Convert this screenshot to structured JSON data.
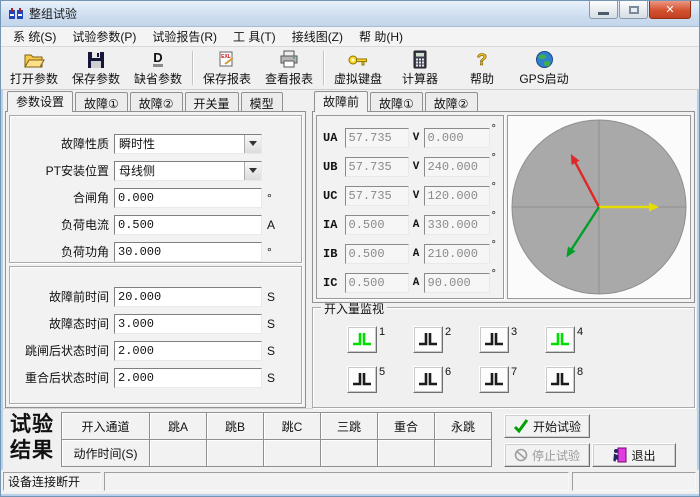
{
  "window": {
    "title": "整组试验"
  },
  "controls": {
    "minimize": "minimize",
    "maximize": "maximize",
    "close": "✕"
  },
  "menu": {
    "items": [
      {
        "label": "系 统(S)"
      },
      {
        "label": "试验参数(P)"
      },
      {
        "label": "试验报告(R)"
      },
      {
        "label": "工 具(T)"
      },
      {
        "label": "接线图(Z)"
      },
      {
        "label": "帮 助(H)"
      }
    ]
  },
  "toolbar": {
    "buttons": [
      {
        "label": "打开参数",
        "icon": "open-folder-icon"
      },
      {
        "label": "保存参数",
        "icon": "save-floppy-icon"
      },
      {
        "label": "缺省参数",
        "icon": "default-params-icon"
      },
      {
        "label": "保存报表",
        "icon": "save-report-icon"
      },
      {
        "label": "查看报表",
        "icon": "printer-icon"
      },
      {
        "label": "虚拟键盘",
        "icon": "key-icon"
      },
      {
        "label": "计算器",
        "icon": "calculator-icon"
      },
      {
        "label": "帮助",
        "icon": "help-icon"
      },
      {
        "label": "GPS启动",
        "icon": "globe-icon"
      }
    ]
  },
  "left_panel": {
    "tabs": [
      "参数设置",
      "故障①",
      "故障②",
      "开关量",
      "模型"
    ],
    "active_tab": "参数设置",
    "params": [
      {
        "label": "故障性质",
        "value": "瞬时性",
        "type": "select"
      },
      {
        "label": "PT安装位置",
        "value": "母线侧",
        "type": "select"
      },
      {
        "label": "合闸角",
        "value": "0.000",
        "unit": "°"
      },
      {
        "label": "负荷电流",
        "value": "0.500",
        "unit": "A"
      },
      {
        "label": "负荷功角",
        "value": "30.000",
        "unit": "°"
      }
    ],
    "times": [
      {
        "label": "故障前时间",
        "value": "20.000",
        "unit": "S"
      },
      {
        "label": "故障态时间",
        "value": "3.000",
        "unit": "S"
      },
      {
        "label": "跳闸后状态时间",
        "value": "2.000",
        "unit": "S"
      },
      {
        "label": "重合后状态时间",
        "value": "2.000",
        "unit": "S"
      }
    ]
  },
  "right_panel": {
    "tabs": [
      "故障前",
      "故障①",
      "故障②"
    ],
    "active_tab": "故障前",
    "channels": [
      {
        "name": "UA",
        "value": "57.735",
        "unit": "V",
        "angle": "0.000",
        "deg": "°"
      },
      {
        "name": "UB",
        "value": "57.735",
        "unit": "V",
        "angle": "240.000",
        "deg": "°"
      },
      {
        "name": "UC",
        "value": "57.735",
        "unit": "V",
        "angle": "120.000",
        "deg": "°"
      },
      {
        "name": "IA",
        "value": "0.500",
        "unit": "A",
        "angle": "330.000",
        "deg": "°"
      },
      {
        "name": "IB",
        "value": "0.500",
        "unit": "A",
        "angle": "210.000",
        "deg": "°"
      },
      {
        "name": "IC",
        "value": "0.500",
        "unit": "A",
        "angle": "90.000",
        "deg": "°"
      }
    ],
    "phasor": {
      "circle_color": "#a9a9a9",
      "axis_color": "#8f8f8f",
      "vectors": [
        {
          "name": "UC",
          "angle_deg": 118,
          "color": "#e02828"
        },
        {
          "name": "UA",
          "angle_deg": 0,
          "color": "#e6de00"
        },
        {
          "name": "UB",
          "angle_deg": 237,
          "color": "#00a028"
        }
      ]
    },
    "monitor": {
      "title": "开入量监视",
      "on_color": "#00dd00",
      "off_color": "#1c1c1c",
      "inputs": [
        {
          "num": "1",
          "state": "on"
        },
        {
          "num": "2",
          "state": "off"
        },
        {
          "num": "3",
          "state": "off"
        },
        {
          "num": "4",
          "state": "on"
        },
        {
          "num": "5",
          "state": "off"
        },
        {
          "num": "6",
          "state": "off"
        },
        {
          "num": "7",
          "state": "off"
        },
        {
          "num": "8",
          "state": "off"
        }
      ]
    }
  },
  "results": {
    "title_line1": "试验",
    "title_line2": "结果",
    "header_row": [
      "开入通道",
      "跳A",
      "跳B",
      "跳C",
      "三跳",
      "重合",
      "永跳"
    ],
    "data_row": [
      "动作时间(S)",
      "",
      "",
      "",
      "",
      "",
      ""
    ],
    "buttons": {
      "start": "开始试验",
      "stop": "停止试验",
      "exit": "退出"
    }
  },
  "statusbar": {
    "text": "设备连接断开"
  }
}
